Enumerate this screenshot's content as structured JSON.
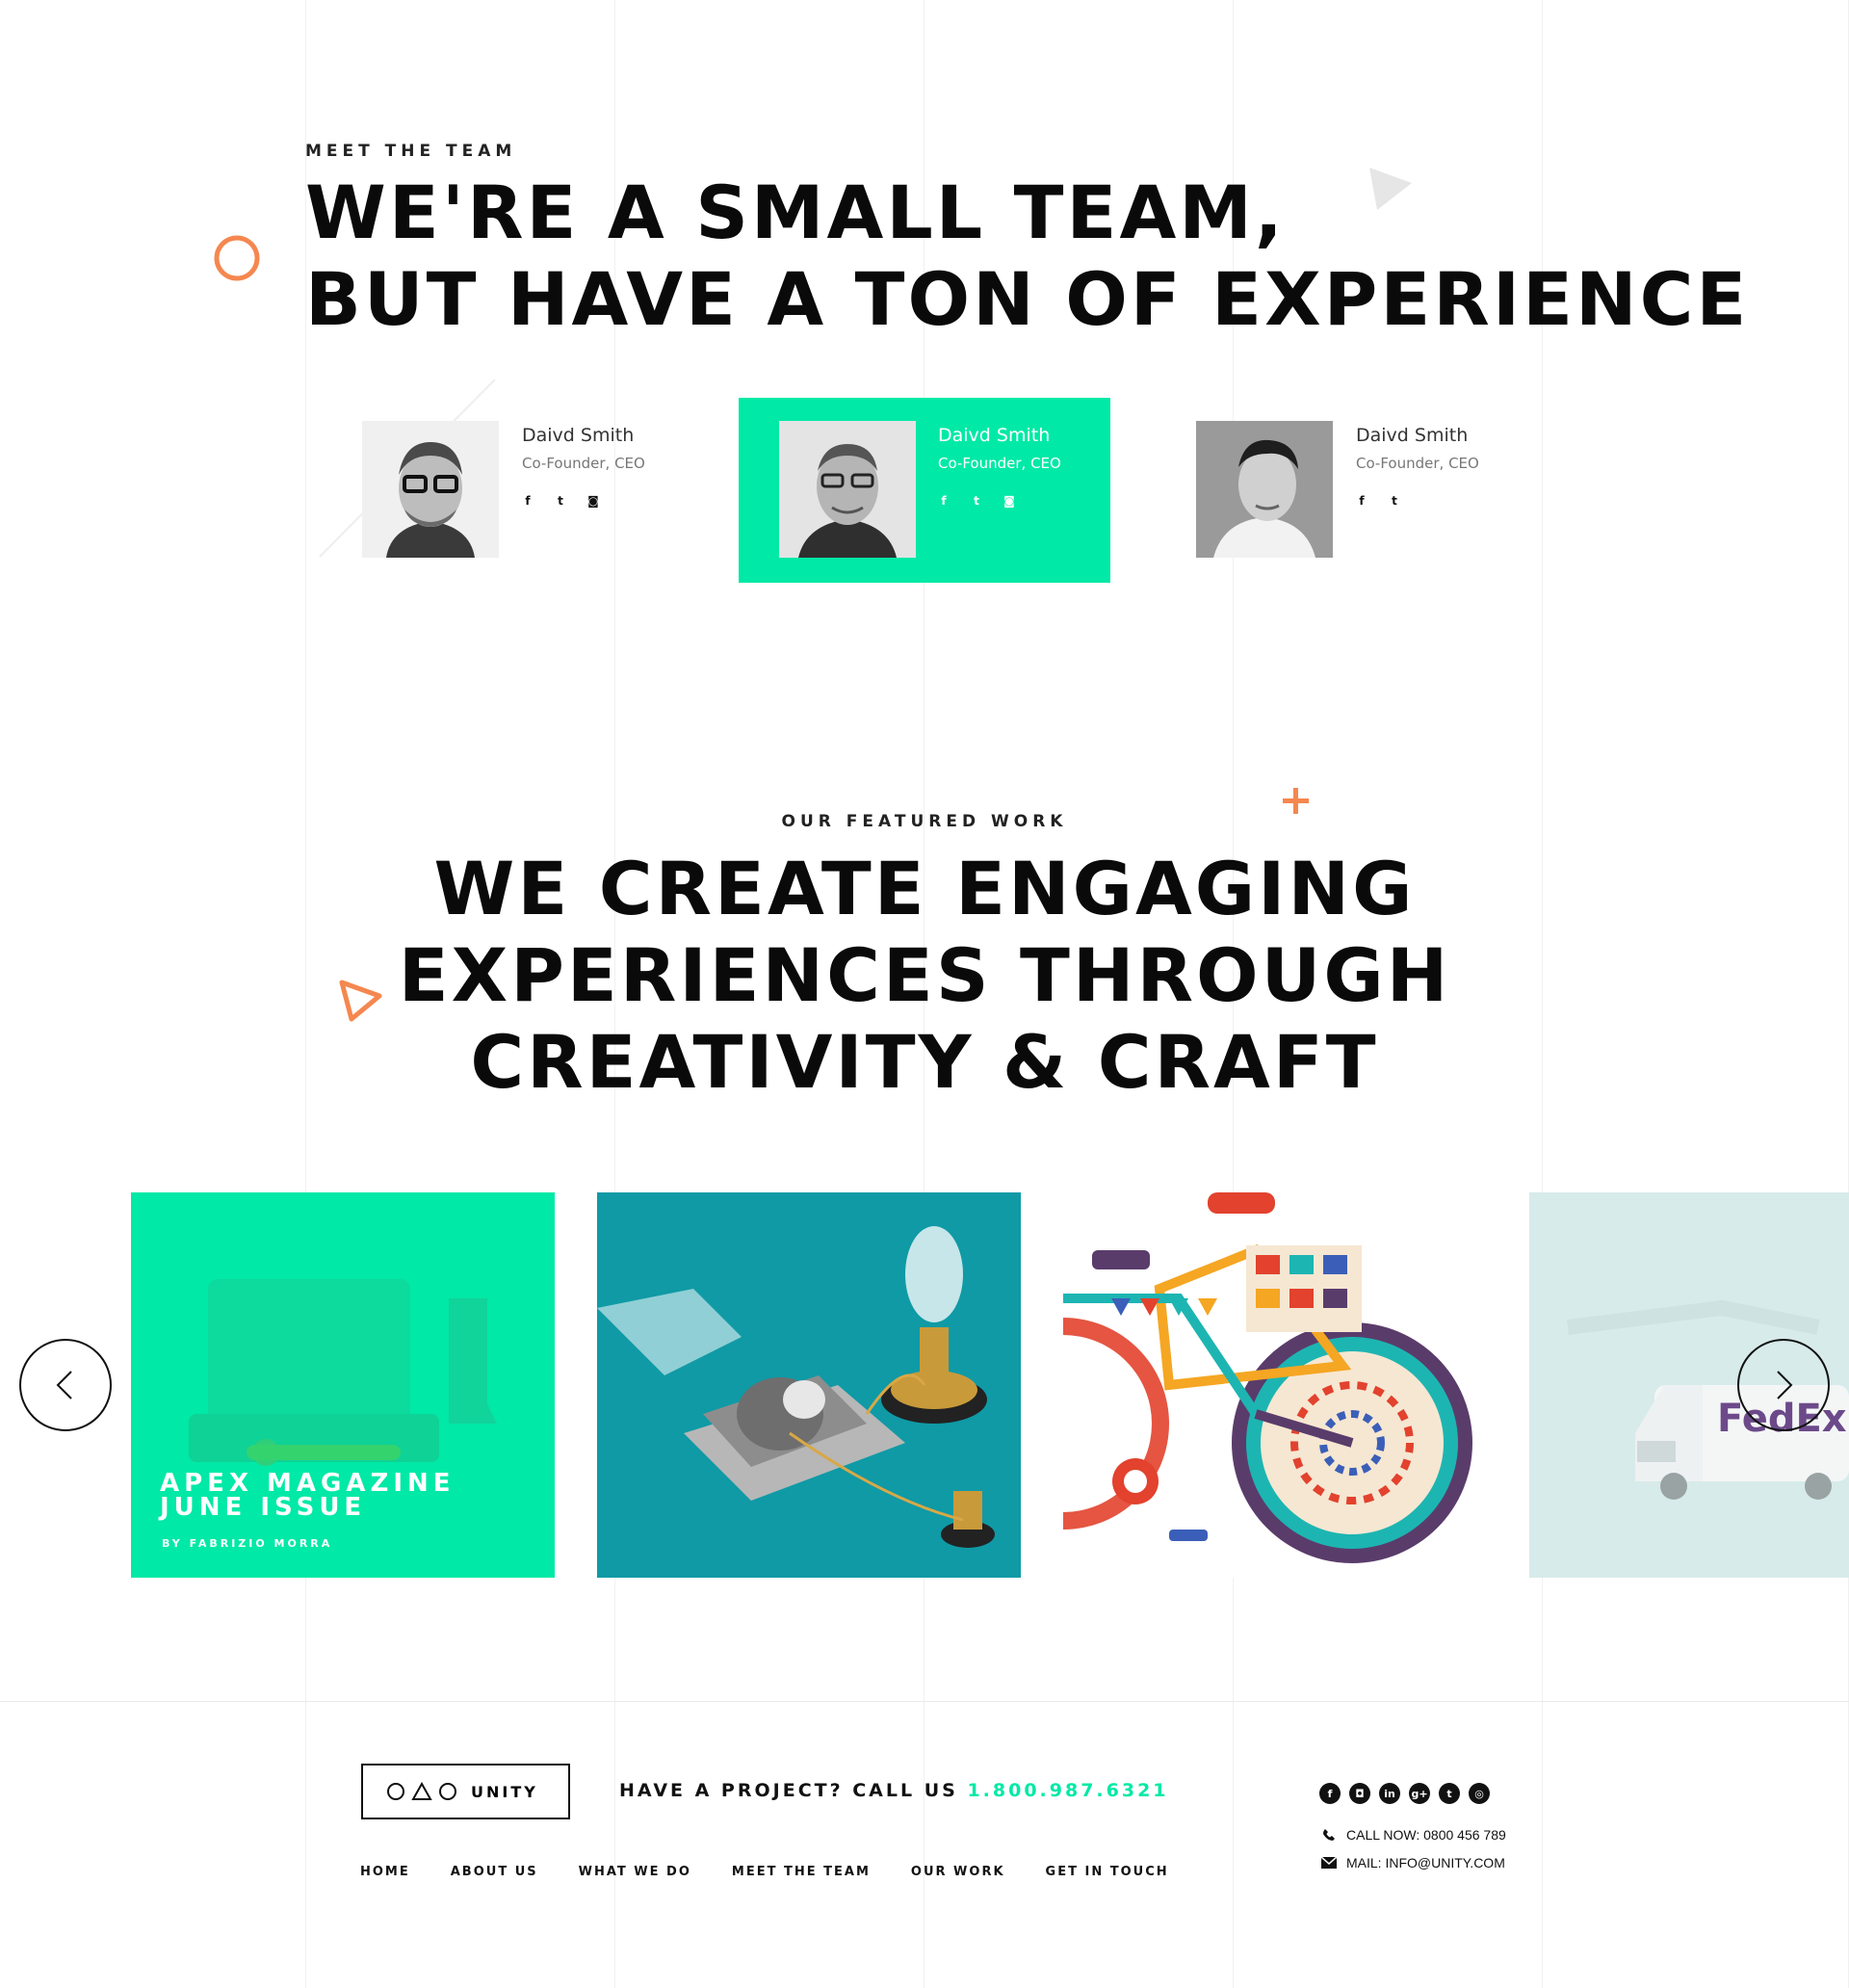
{
  "team_section": {
    "eyebrow": "MEET THE TEAM",
    "headline_line1": "WE'RE A SMALL TEAM,",
    "headline_line2": "BUT HAVE A TON OF EXPERIENCE",
    "members": [
      {
        "name": "Daivd Smith",
        "role": "Co-Founder, CEO",
        "socials": [
          "f",
          "t",
          "i"
        ],
        "highlighted": false
      },
      {
        "name": "Daivd Smith",
        "role": "Co-Founder, CEO",
        "socials": [
          "f",
          "t",
          "i"
        ],
        "highlighted": true
      },
      {
        "name": "Daivd Smith",
        "role": "Co-Founder, CEO",
        "socials": [
          "f",
          "t"
        ],
        "highlighted": false
      }
    ]
  },
  "work_section": {
    "eyebrow": "OUR FEATURED WORK",
    "headline_line1": "WE CREATE ENGAGING",
    "headline_line2": "EXPERIENCES THROUGH",
    "headline_line3": "CREATIVITY & CRAFT",
    "featured_tile": {
      "title_line1": "APEX MAGAZINE",
      "title_line2": "JUNE ISSUE",
      "byline": "BY FABRIZIO MORRA"
    },
    "van_logo_text": "FedEx",
    "prev_icon": "chevron-left-icon",
    "next_icon": "chevron-right-icon"
  },
  "footer": {
    "logo_text": "UNITY",
    "cta_text": "HAVE A PROJECT? CALL US ",
    "cta_phone": "1.800.987.6321",
    "nav": [
      "HOME",
      "ABOUT US",
      "WHAT WE DO",
      "MEET THE TEAM",
      "OUR WORK",
      "GET IN TOUCH"
    ],
    "social_icons": [
      "facebook-icon",
      "instagram-icon",
      "linkedin-icon",
      "google-plus-icon",
      "twitter-icon",
      "dribbble-icon"
    ],
    "call_text": "CALL NOW: 0800  456  789",
    "mail_text": "MAIL: INFO@UNITY.COM"
  },
  "colors": {
    "accent_green": "#00e9a6",
    "accent_orange": "#f5874f",
    "text_dark": "#0a0a0a"
  }
}
